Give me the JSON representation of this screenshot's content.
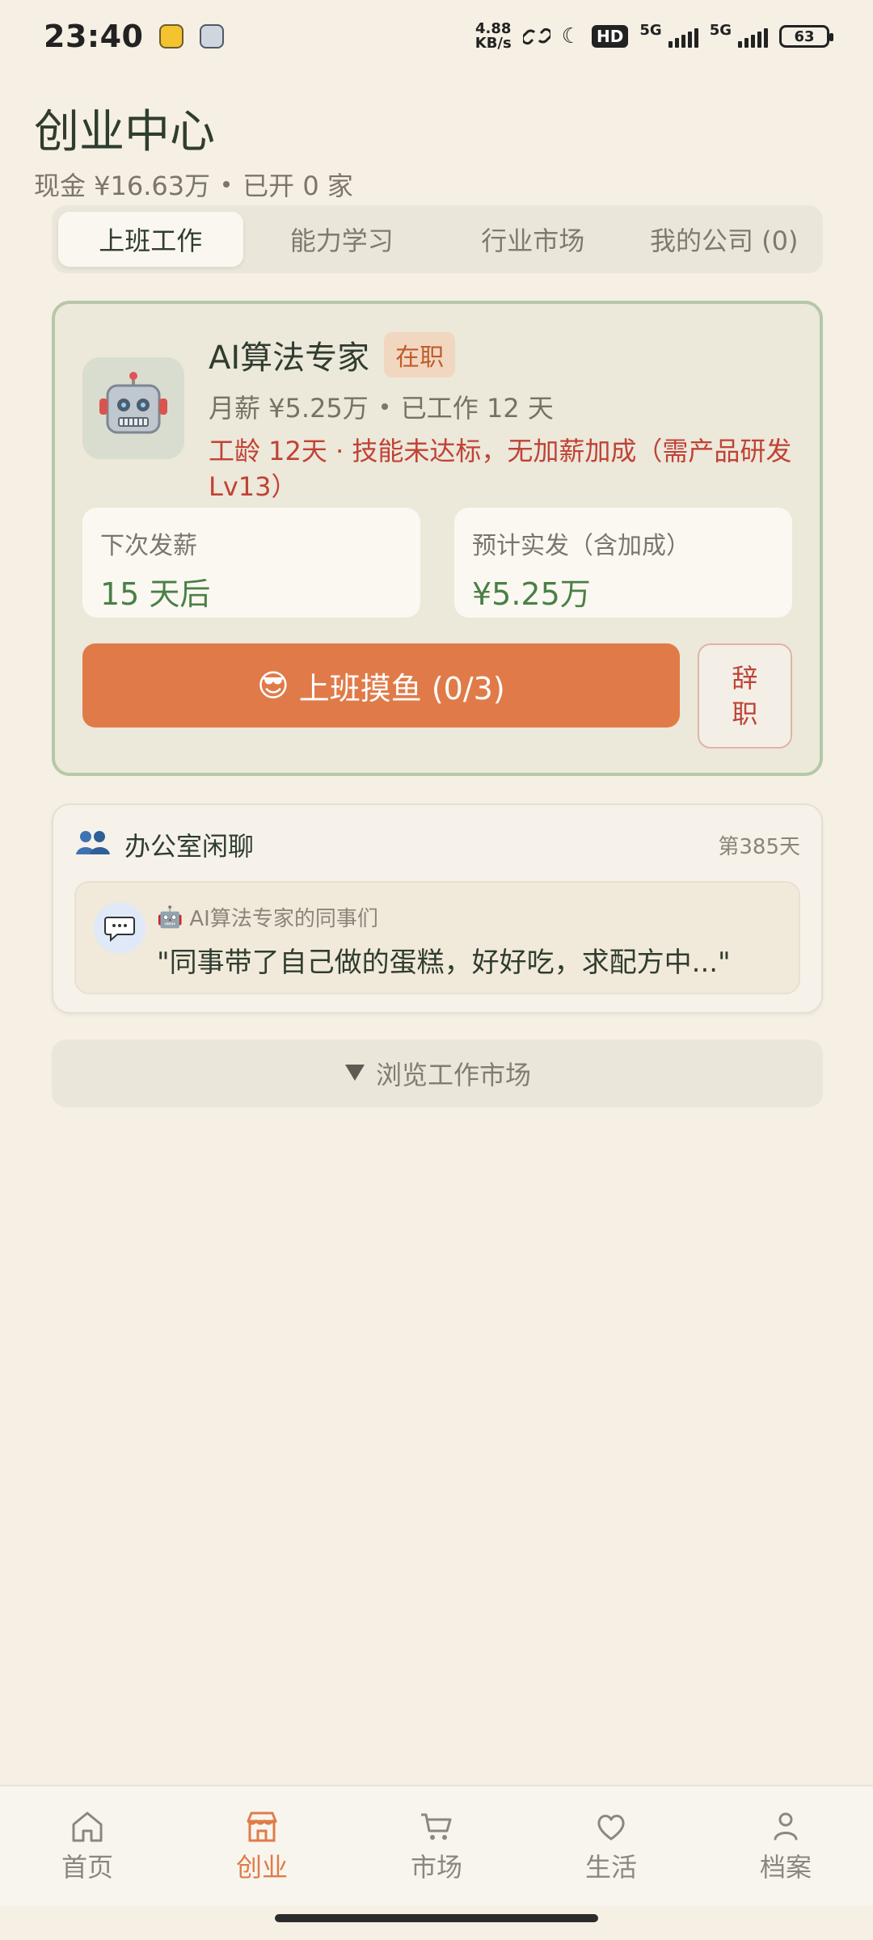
{
  "status_bar": {
    "time": "23:40",
    "net_speed_value": "4.88",
    "net_speed_unit": "KB/s",
    "hd": "HD",
    "network1": "5G",
    "network2": "5G",
    "battery": "63"
  },
  "header": {
    "title": "创业中心",
    "cash": "现金 ¥16.63万",
    "opened": "已开 0 家"
  },
  "tabs": [
    {
      "label": "上班工作"
    },
    {
      "label": "能力学习"
    },
    {
      "label": "行业市场"
    },
    {
      "label": "我的公司 (0)"
    }
  ],
  "job_card": {
    "title": "AI算法专家",
    "status_badge": "在职",
    "salary": "月薪 ¥5.25万",
    "worked": "已工作 12 天",
    "warning": "工龄 12天 · 技能未达标，无加薪加成（需产品研发Lv13）",
    "next_pay_label": "下次发薪",
    "next_pay_value": "15 天后",
    "expected_label": "预计实发（含加成）",
    "expected_value": "¥5.25万",
    "primary_button": "上班摸鱼 (0/3)",
    "resign_button_line1": "辞",
    "resign_button_line2": "职"
  },
  "chat": {
    "title": "办公室闲聊",
    "day": "第385天",
    "sender": "AI算法专家的同事们",
    "message": "\"同事带了自己做的蛋糕，好好吃，求配方中...\""
  },
  "browse_button": "浏览工作市场",
  "bottom_nav": [
    {
      "label": "首页"
    },
    {
      "label": "创业"
    },
    {
      "label": "市场"
    },
    {
      "label": "生活"
    },
    {
      "label": "档案"
    }
  ],
  "colors": {
    "accent": "#df7c4a",
    "green": "#4a7f46",
    "warning": "#c04236"
  }
}
